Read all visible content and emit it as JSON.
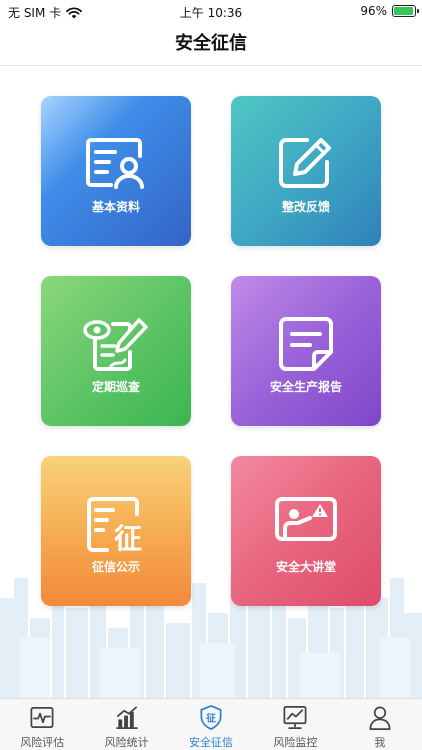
{
  "status_bar": {
    "carrier": "无 SIM 卡",
    "time": "上午 10:36",
    "battery": "96%",
    "battery_level": 0.96
  },
  "header": {
    "title": "安全征信"
  },
  "tiles": [
    {
      "label": "基本资料",
      "icon": "profile-card-icon"
    },
    {
      "label": "整改反馈",
      "icon": "edit-pencil-icon"
    },
    {
      "label": "定期巡查",
      "icon": "inspection-checklist-icon"
    },
    {
      "label": "安全生产报告",
      "icon": "report-note-icon"
    },
    {
      "label": "征信公示",
      "icon": "credit-notice-icon"
    },
    {
      "label": "安全大讲堂",
      "icon": "lecture-board-icon"
    }
  ],
  "tabs": [
    {
      "label": "风险评估",
      "icon": "pulse-monitor-icon",
      "active": false
    },
    {
      "label": "风险统计",
      "icon": "bar-chart-icon",
      "active": false
    },
    {
      "label": "安全征信",
      "icon": "shield-credit-icon",
      "active": true
    },
    {
      "label": "风险监控",
      "icon": "trend-monitor-icon",
      "active": false
    },
    {
      "label": "我",
      "icon": "person-icon",
      "active": false
    }
  ],
  "colors": {
    "accent": "#2b7fd8",
    "tab_inactive": "#555555"
  }
}
